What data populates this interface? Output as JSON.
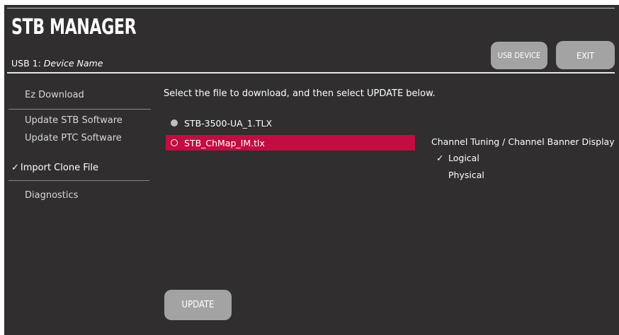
{
  "header": {
    "title": "STB MANAGER",
    "device_prefix": "USB 1:",
    "device_name": "Device Name",
    "usb_device_label": "USB DEVICE",
    "exit_label": "EXIT"
  },
  "sidebar": {
    "items": [
      {
        "label": "Ez Download",
        "selected": false
      },
      {
        "label": "Update STB Software",
        "selected": false
      },
      {
        "label": "Update PTC Software",
        "selected": false
      },
      {
        "label": "Import Clone File",
        "selected": true
      },
      {
        "label": "Diagnostics",
        "selected": false
      }
    ]
  },
  "main": {
    "instruction": "Select the file to download, and then select UPDATE below.",
    "files": [
      {
        "name": "STB-3500-UA_1.TLX",
        "selected": false
      },
      {
        "name": "STB_ChMap_IM.tlx",
        "selected": true
      }
    ],
    "update_label": "UPDATE"
  },
  "channel_options": {
    "heading": "Channel Tuning / Channel Banner Display",
    "options": [
      {
        "label": "Logical",
        "checked": true
      },
      {
        "label": "Physical",
        "checked": false
      }
    ]
  },
  "colors": {
    "background": "#302e2f",
    "highlight": "#c10d40",
    "button": "#a3a3a3",
    "text": "#ffffff"
  },
  "icons": {
    "check": "checkmark-icon",
    "radio_filled": "radio-filled-icon",
    "radio_empty": "radio-empty-icon"
  }
}
